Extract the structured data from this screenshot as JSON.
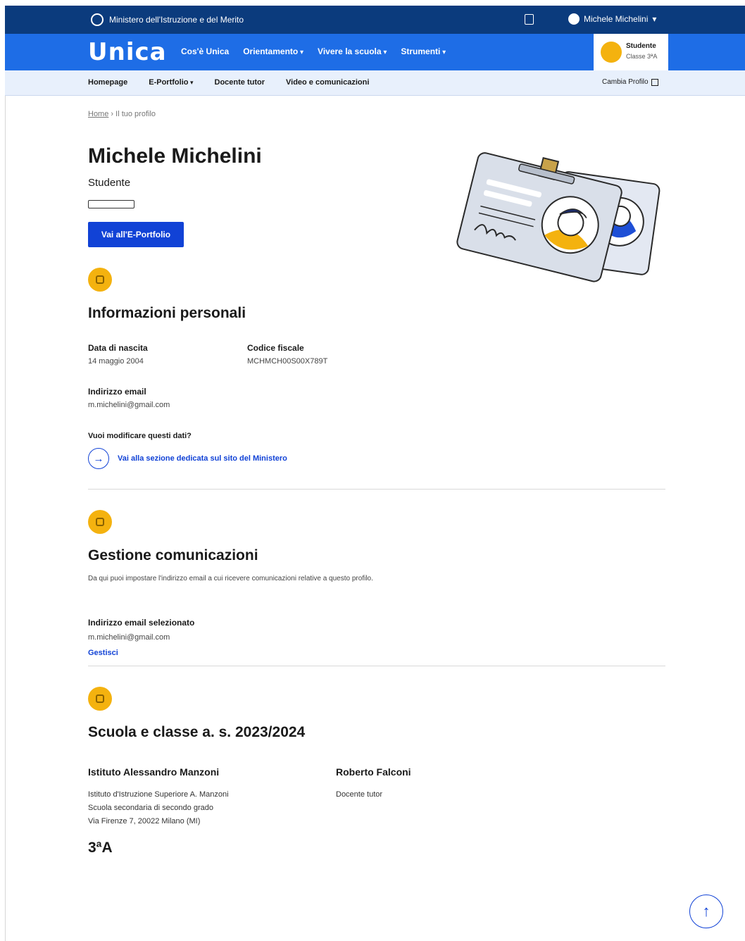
{
  "ministry": {
    "name": "Ministero dell'Istruzione e del Merito"
  },
  "user_menu": {
    "name": "Michele Michelini"
  },
  "brand": {
    "logo": "Unica"
  },
  "main_nav": [
    "Cos'è Unica",
    "Orientamento",
    "Vivere la scuola",
    "Strumenti"
  ],
  "student_card": {
    "role": "Studente",
    "class": "Classe 3ªA"
  },
  "sub_nav": {
    "items": [
      "Homepage",
      "E-Portfolio",
      "Docente tutor",
      "Video e comunicazioni"
    ],
    "change_profile": "Cambia Profilo"
  },
  "breadcrumb": {
    "home": "Home",
    "current": "Il tuo profilo"
  },
  "profile": {
    "name": "Michele Michelini",
    "role": "Studente",
    "button": "Vai all'E-Portfolio"
  },
  "personal": {
    "title": "Informazioni personali",
    "birth_label": "Data di nascita",
    "birth_value": "14 maggio 2004",
    "cf_label": "Codice fiscale",
    "cf_value": "MCHMCH00S00X789T",
    "email_label": "Indirizzo email",
    "email_value": "m.michelini@gmail.com",
    "question": "Vuoi modificare questi dati?",
    "link": "Vai alla sezione dedicata sul sito del Ministero"
  },
  "comms": {
    "title": "Gestione comunicazioni",
    "description": "Da qui puoi impostare l'indirizzo email a cui ricevere comunicazioni relative a questo profilo.",
    "email_label": "Indirizzo email selezionato",
    "email_value": "m.michelini@gmail.com",
    "manage": "Gestisci"
  },
  "school": {
    "title": "Scuola e classe a. s. 2023/2024",
    "name": "Istituto Alessandro Manzoni",
    "full_name": "Istituto d'Istruzione Superiore A. Manzoni",
    "type": "Scuola secondaria di secondo grado",
    "address": "Via Firenze 7, 20022 Milano (MI)",
    "teacher": "Roberto Falconi",
    "teacher_role": "Docente tutor",
    "class": "3ªA"
  },
  "colors": {
    "dark_blue": "#0b3b7d",
    "brand_blue": "#1e6de6",
    "button_blue": "#1142d6",
    "accent_yellow": "#f4b20f"
  }
}
